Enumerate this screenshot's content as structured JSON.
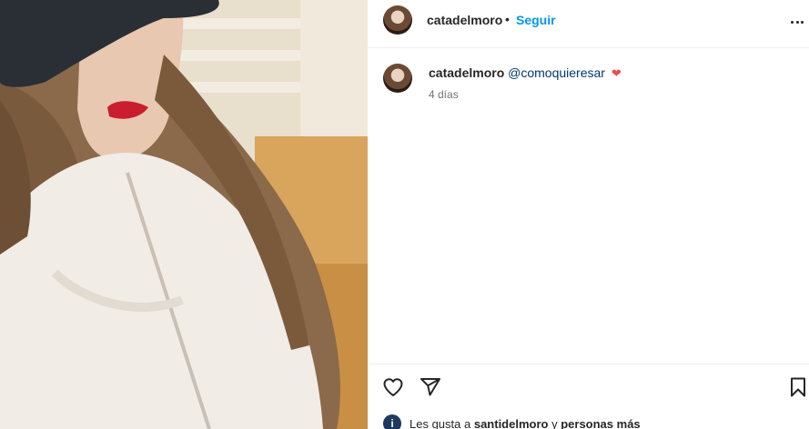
{
  "header": {
    "username": "catadelmoro",
    "separator": "•",
    "follow_label": "Seguir",
    "more_icon": "more-options-icon"
  },
  "caption": {
    "username": "catadelmoro",
    "mention": "@comoquieresar",
    "emoji": "❤",
    "time": "4 días"
  },
  "actions": {
    "like_icon": "heart-icon",
    "share_icon": "paper-plane-icon",
    "save_icon": "bookmark-icon"
  },
  "likes": {
    "prefix": "Les gusta a",
    "user": "santidelmoro",
    "conjunction": "y",
    "others": "personas más"
  },
  "colors": {
    "link_blue": "#0095f6",
    "mention_blue": "#00376b",
    "heart_red": "#ed4956",
    "muted": "#737373"
  }
}
